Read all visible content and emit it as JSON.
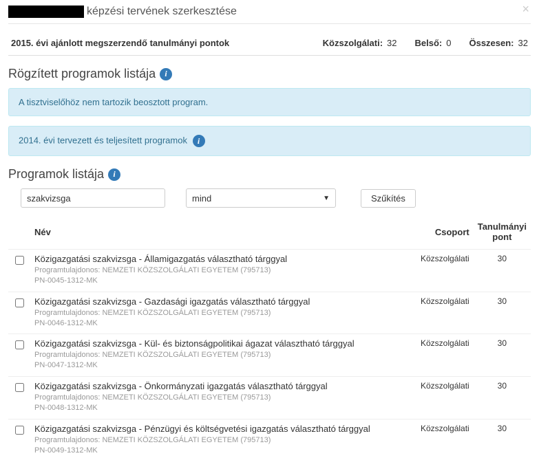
{
  "header": {
    "title_suffix": "képzési tervének szerkesztése"
  },
  "points": {
    "lead": "2015. évi ajánlott megszerzendő tanulmányi pontok",
    "kozszolgalati_label": "Közszolgálati:",
    "kozszolgalati_value": "32",
    "belso_label": "Belső:",
    "belso_value": "0",
    "osszesen_label": "Összesen:",
    "osszesen_value": "32"
  },
  "sections": {
    "fixed_title": "Rögzített programok listája",
    "list_title": "Programok listája"
  },
  "alerts": {
    "no_assigned": "A tisztviselőhöz nem tartozik beosztott program.",
    "planned": "2014. évi tervezett és teljesített programok"
  },
  "filter": {
    "search_value": "szakvizsga",
    "select_value": "mind",
    "button_label": "Szűkítés"
  },
  "columns": {
    "name": "Név",
    "group": "Csoport",
    "points": "Tanulmányi pont"
  },
  "rows": [
    {
      "title": "Közigazgatási szakvizsga - Államigazgatás választható tárggyal",
      "owner": "Programtulajdonos: NEMZETI KÖZSZOLGÁLATI EGYETEM (795713)",
      "code": "PN-0045-1312-MK",
      "group": "Közszolgálati",
      "points": "30"
    },
    {
      "title": "Közigazgatási szakvizsga - Gazdasági igazgatás választható tárggyal",
      "owner": "Programtulajdonos: NEMZETI KÖZSZOLGÁLATI EGYETEM (795713)",
      "code": "PN-0046-1312-MK",
      "group": "Közszolgálati",
      "points": "30"
    },
    {
      "title": "Közigazgatási szakvizsga - Kül- és biztonságpolitikai ágazat választható tárggyal",
      "owner": "Programtulajdonos: NEMZETI KÖZSZOLGÁLATI EGYETEM (795713)",
      "code": "PN-0047-1312-MK",
      "group": "Közszolgálati",
      "points": "30"
    },
    {
      "title": "Közigazgatási szakvizsga - Önkormányzati igazgatás választható tárggyal",
      "owner": "Programtulajdonos: NEMZETI KÖZSZOLGÁLATI EGYETEM (795713)",
      "code": "PN-0048-1312-MK",
      "group": "Közszolgálati",
      "points": "30"
    },
    {
      "title": "Közigazgatási szakvizsga - Pénzügyi és költségvetési igazgatás választható tárggyal",
      "owner": "Programtulajdonos: NEMZETI KÖZSZOLGÁLATI EGYETEM (795713)",
      "code": "PN-0049-1312-MK",
      "group": "Közszolgálati",
      "points": "30"
    }
  ]
}
